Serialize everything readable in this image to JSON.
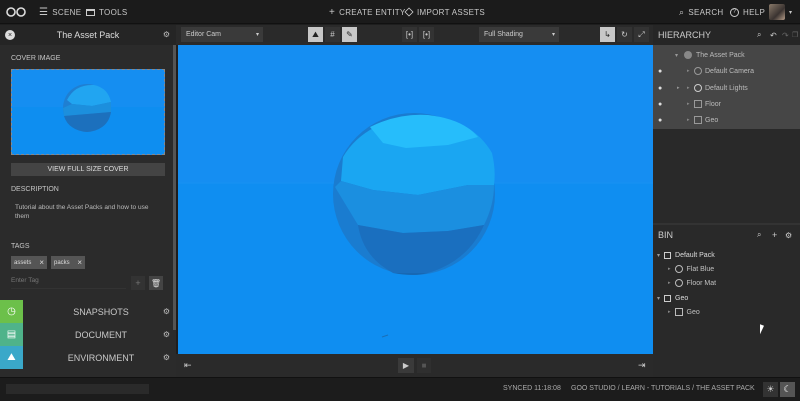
{
  "topbar": {
    "scene_label": "SCENE",
    "tools_label": "TOOLS",
    "create_entity_label": "CREATE ENTITY",
    "import_assets_label": "IMPORT ASSETS",
    "search_label": "SEARCH",
    "help_label": "HELP"
  },
  "left_panel": {
    "title": "The Asset Pack",
    "cover_image_label": "COVER IMAGE",
    "view_cover_button": "VIEW FULL SIZE COVER",
    "description_label": "DESCRIPTION",
    "description_text": "Tutorial about the Asset Packs and how to use them",
    "tags_label": "TAGS",
    "tags": [
      "assets",
      "packs"
    ],
    "tag_input_placeholder": "Enter Tag",
    "sections": [
      {
        "label": "SNAPSHOTS"
      },
      {
        "label": "DOCUMENT"
      },
      {
        "label": "ENVIRONMENT"
      }
    ]
  },
  "viewport_toolbar": {
    "camera_select": "Editor Cam",
    "shading_select": "Full Shading"
  },
  "hierarchy": {
    "title": "HIERARCHY",
    "items": [
      {
        "label": "The Asset Pack"
      },
      {
        "label": "Default Camera"
      },
      {
        "label": "Default Lights"
      },
      {
        "label": "Floor"
      },
      {
        "label": "Geo"
      }
    ]
  },
  "bin": {
    "title": "BIN",
    "items": [
      {
        "label": "Default Pack"
      },
      {
        "label": "Flat Blue"
      },
      {
        "label": "Floor Mat"
      },
      {
        "label": "Geo"
      },
      {
        "label": "Geo"
      }
    ]
  },
  "statusbar": {
    "synced_text": "SYNCED 11:18:08",
    "breadcrumb": "GOO STUDIO / LEARN - TUTORIALS / THE ASSET PACK"
  },
  "colors": {
    "viewport_bg": "#128ef2",
    "sphere_light": "#19b4fb",
    "sidebar_green": "#6cc04a",
    "panel_bg": "#2b2b2b"
  }
}
